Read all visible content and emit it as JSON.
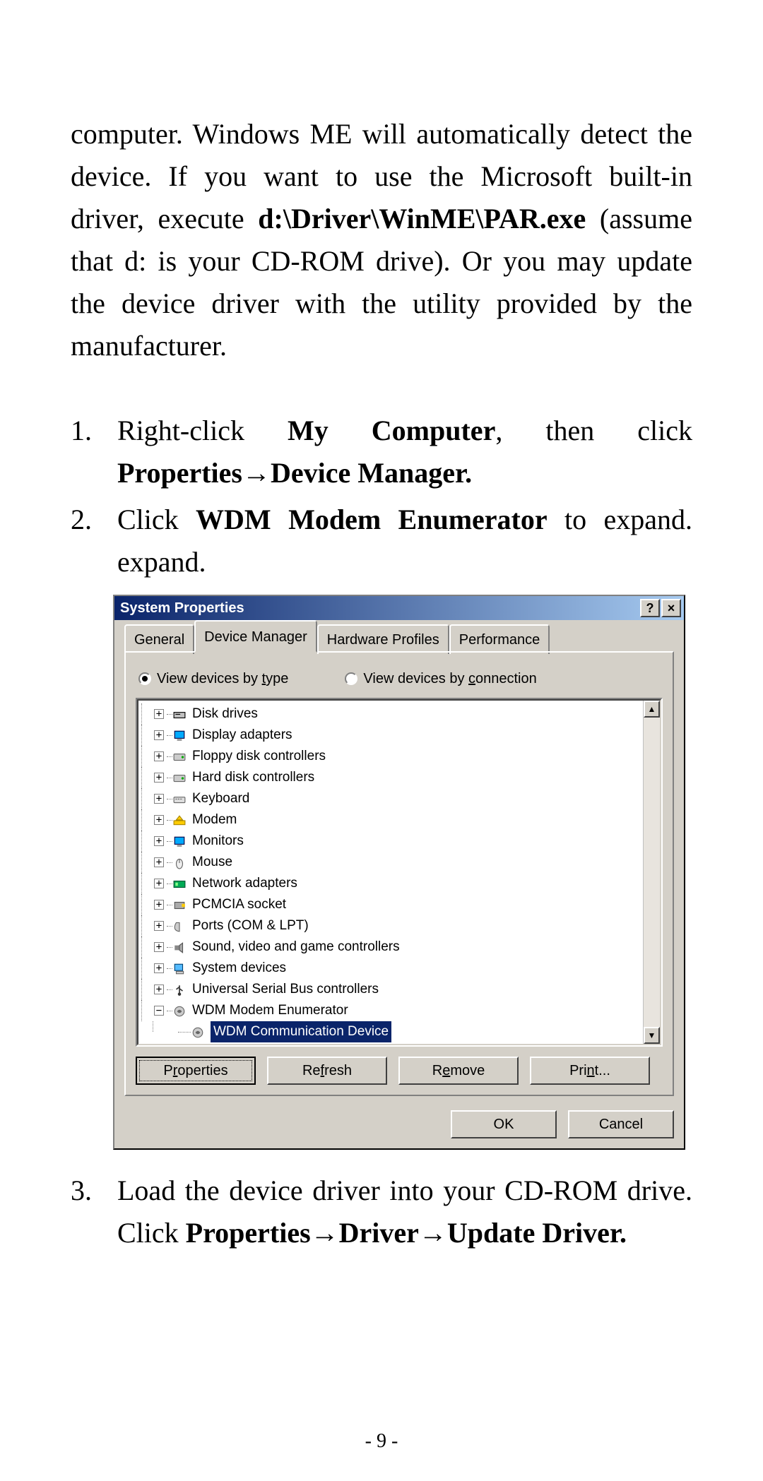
{
  "page_number": "- 9 -",
  "intro": {
    "line1_a": "computer. Windows ME will automatically detect the device. If you want to use the Microsoft built-in driver, execute ",
    "bold_path": "d:\\Driver\\WinME\\PAR.exe",
    "line1_b": " (assume that d: is your CD-ROM drive).  Or you may update the device driver with the utility provided by the manufacturer."
  },
  "steps": {
    "s1": {
      "num": "1.",
      "t1": "Right-click ",
      "b1": "My Computer",
      "t2": ", then click ",
      "b2": "Properties",
      "arrow": "→",
      "b3": "Device Manager."
    },
    "s2": {
      "num": "2.",
      "t1": "Click ",
      "b1": "WDM Modem Enumerator",
      "t2": " to expand."
    },
    "s3": {
      "num": "3.",
      "t1": "Load the device driver into your CD-ROM drive.  Click ",
      "b1": "Properties",
      "arrow1": "→",
      "b2": "Driver",
      "arrow2": "→",
      "b3": "Update Driver."
    }
  },
  "dialog": {
    "title": "System Properties",
    "help_btn": "?",
    "close_btn": "×",
    "tabs": {
      "general": "General",
      "device_manager": "Device Manager",
      "hardware_profiles": "Hardware Profiles",
      "performance": "Performance"
    },
    "radios": {
      "by_type": "View devices by type",
      "by_connection": "View devices by connection"
    },
    "tree": [
      {
        "expander": "+",
        "label": "Disk drives"
      },
      {
        "expander": "+",
        "label": "Display adapters"
      },
      {
        "expander": "+",
        "label": "Floppy disk controllers"
      },
      {
        "expander": "+",
        "label": "Hard disk controllers"
      },
      {
        "expander": "+",
        "label": "Keyboard"
      },
      {
        "expander": "+",
        "label": "Modem"
      },
      {
        "expander": "+",
        "label": "Monitors"
      },
      {
        "expander": "+",
        "label": "Mouse"
      },
      {
        "expander": "+",
        "label": "Network adapters"
      },
      {
        "expander": "+",
        "label": "PCMCIA socket"
      },
      {
        "expander": "+",
        "label": "Ports (COM & LPT)"
      },
      {
        "expander": "+",
        "label": "Sound, video and game controllers"
      },
      {
        "expander": "+",
        "label": "System devices"
      },
      {
        "expander": "+",
        "label": "Universal Serial Bus controllers"
      },
      {
        "expander": "−",
        "label": "WDM Modem Enumerator"
      }
    ],
    "selected_child": "WDM Communication Device",
    "buttons": {
      "properties": "Properties",
      "refresh": "Refresh",
      "remove": "Remove",
      "print": "Print...",
      "ok": "OK",
      "cancel": "Cancel"
    },
    "scroll_up": "▲",
    "scroll_down": "▼"
  }
}
